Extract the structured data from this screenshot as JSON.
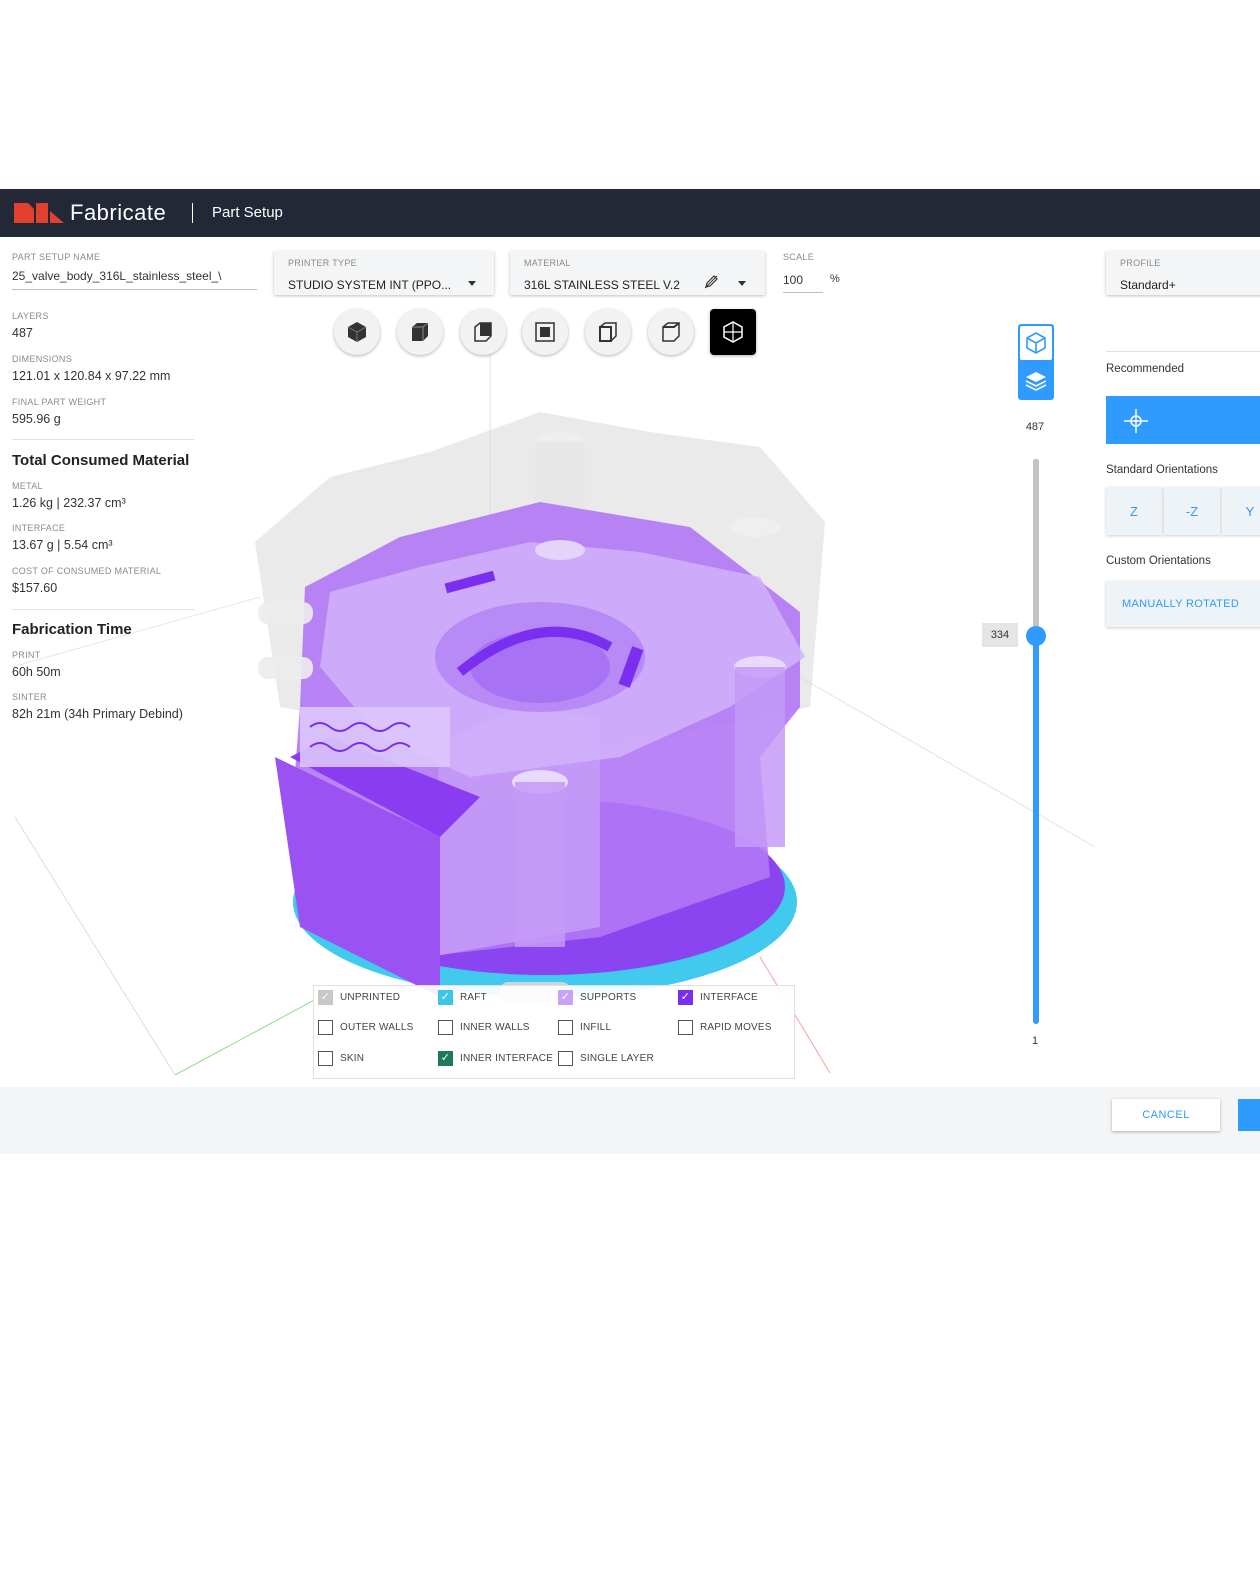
{
  "header": {
    "brand": "Fabricate",
    "crumb": "Part Setup"
  },
  "setup": {
    "name_label": "Part Setup Name",
    "name_value": "25_valve_body_316L_stainless_steel_\\",
    "printer": {
      "label": "PRINTER TYPE",
      "value": "STUDIO SYSTEM INT (PPO..."
    },
    "material": {
      "label": "MATERIAL",
      "value": "316L STAINLESS STEEL V.2"
    },
    "scale": {
      "label": "SCALE",
      "value": "100",
      "unit": "%"
    },
    "profile": {
      "label": "PROFILE",
      "value": "Standard+"
    }
  },
  "stats": {
    "layers_label": "LAYERS",
    "layers": "487",
    "dims_label": "DIMENSIONS",
    "dims": "121.01 x 120.84 x 97.22 mm",
    "weight_label": "FINAL PART WEIGHT",
    "weight": "595.96 g"
  },
  "material_section": {
    "title": "Total Consumed Material",
    "metal_label": "METAL",
    "metal": "1.26 kg | 232.37 cm³",
    "interface_label": "INTERFACE",
    "interface": "13.67 g | 5.54 cm³",
    "cost_label": "COST OF CONSUMED MATERIAL",
    "cost": "$157.60"
  },
  "time_section": {
    "title": "Fabrication Time",
    "print_label": "PRINT",
    "print": "60h 50m",
    "sinter_label": "SINTER",
    "sinter": "82h 21m (34h Primary Debind)"
  },
  "slider": {
    "max": "487",
    "current": "334",
    "min": "1",
    "current_fraction": 0.684
  },
  "orientation": {
    "recommended_label": "Recommended",
    "standard_label": "Standard Orientations",
    "standard": [
      "Z",
      "-Z",
      "Y"
    ],
    "custom_label": "Custom Orientations",
    "custom_button": "MANUALLY ROTATED"
  },
  "legend": [
    {
      "label": "UNPRINTED",
      "checked": true,
      "color": "#c8c8c8"
    },
    {
      "label": "RAFT",
      "checked": true,
      "color": "#3cc6e6"
    },
    {
      "label": "SUPPORTS",
      "checked": true,
      "color": "#c9a3f5"
    },
    {
      "label": "INTERFACE",
      "checked": true,
      "color": "#7a2ff0"
    },
    {
      "label": "OUTER WALLS",
      "checked": false,
      "color": ""
    },
    {
      "label": "INNER WALLS",
      "checked": false,
      "color": ""
    },
    {
      "label": "INFILL",
      "checked": false,
      "color": ""
    },
    {
      "label": "RAPID MOVES",
      "checked": false,
      "color": ""
    },
    {
      "label": "SKIN",
      "checked": false,
      "color": ""
    },
    {
      "label": "INNER INTERFACE",
      "checked": true,
      "color": "#1f7a5a"
    },
    {
      "label": "SINGLE LAYER",
      "checked": false,
      "color": ""
    }
  ],
  "footer": {
    "cancel": "CANCEL"
  },
  "colors": {
    "accent": "#2f9bff",
    "topbar": "#232836",
    "logo": "#e2402f",
    "part": "#a56af2"
  },
  "icons": [
    "logo-icon",
    "view-iso-solid-icon",
    "view-front-icon",
    "view-right-icon",
    "view-top-icon",
    "view-left-icon",
    "view-back-icon",
    "view-perspective-icon",
    "model-view-icon",
    "layers-view-icon",
    "edit-pencil-icon",
    "recommended-orientation-icon"
  ]
}
